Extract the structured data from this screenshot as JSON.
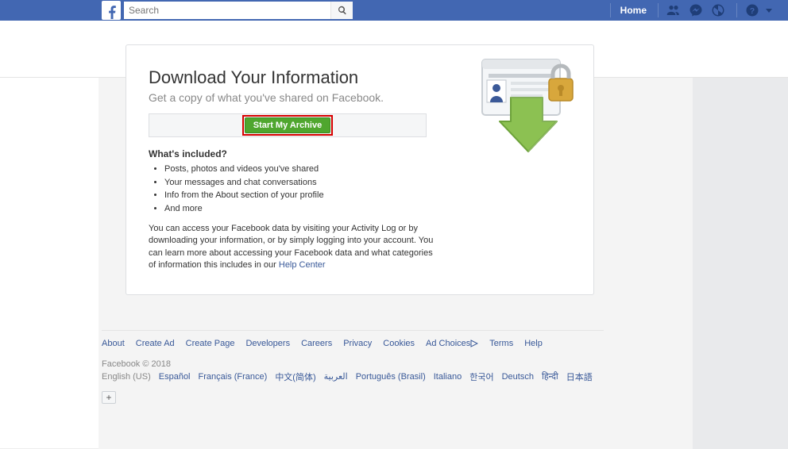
{
  "header": {
    "search_placeholder": "Search",
    "home": "Home"
  },
  "page": {
    "title": "Download Your Information",
    "subtitle": "Get a copy of what you've shared on Facebook.",
    "start_button": "Start My Archive",
    "included_heading": "What's included?",
    "included": [
      "Posts, photos and videos you've shared",
      "Your messages and chat conversations",
      "Info from the About section of your profile",
      "And more"
    ],
    "access_text_1": "You can access your Facebook data by visiting your Activity Log or by downloading your information, or by simply logging into your account. You can learn more about accessing your Facebook data and what categories of information this includes in our ",
    "help_link": "Help Center"
  },
  "footer": {
    "links": [
      "About",
      "Create Ad",
      "Create Page",
      "Developers",
      "Careers",
      "Privacy",
      "Cookies",
      "Ad Choices",
      "Terms",
      "Help"
    ],
    "copyright": "Facebook © 2018",
    "languages": [
      "English (US)",
      "Español",
      "Français (France)",
      "中文(简体)",
      "العربية",
      "Português (Brasil)",
      "Italiano",
      "한국어",
      "Deutsch",
      "हिन्दी",
      "日本語"
    ],
    "plus": "+"
  }
}
